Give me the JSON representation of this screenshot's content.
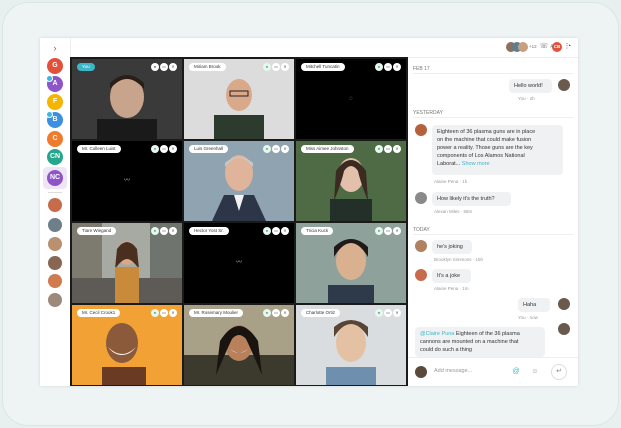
{
  "rail": {
    "collapse_icon": "chevron-right-icon",
    "spaces": [
      {
        "label": "G",
        "color": "#e2513c"
      },
      {
        "label": "A",
        "color": "#8e55c8"
      },
      {
        "label": "F",
        "color": "#f4b400"
      },
      {
        "label": "B",
        "color": "#3d8fe0"
      },
      {
        "label": "C",
        "color": "#f07b2c"
      },
      {
        "label": "CN",
        "color": "#24a78c"
      },
      {
        "label": "NC",
        "color": "#8e55c8"
      }
    ]
  },
  "tiles": [
    {
      "name": "You"
    },
    {
      "name": "Miriam Brook"
    },
    {
      "name": "Mitchell Tuncatin"
    },
    {
      "name": "Mr. Colleen Luist"
    },
    {
      "name": "Luis Greenhall"
    },
    {
      "name": "Miss Aimee Johnston"
    },
    {
      "name": "Tiare Wiegand"
    },
    {
      "name": "Hector Yost Sr."
    },
    {
      "name": "Tricia Kuck"
    },
    {
      "name": "Mr. Cecil Crook1"
    },
    {
      "name": "Mr. Rosemary Moulier"
    },
    {
      "name": "Charlotte Ortiz"
    }
  ],
  "tile_controls": [
    "mic-icon",
    "camera-icon",
    "close-icon"
  ],
  "header": {
    "participant_count": "+12",
    "icons": [
      "phone-icon",
      "cb-badge",
      "clock-icon",
      "search-icon",
      "more-vertical-icon"
    ],
    "badge": "CB"
  },
  "chat": {
    "sections": {
      "feb": "FEB 17",
      "yesterday": "YESTERDAY",
      "today": "TODAY"
    },
    "messages": [
      {
        "text": "Hello world!",
        "meta": "You · 2h"
      },
      {
        "text_lines": [
          "Eighteen of 36 plasma guns are in place",
          "on the machine that could make  fusion",
          "power a reality. Those guns are the key",
          "components of Los Alamos National"
        ],
        "last_line": "Laborat...",
        "link": "Show more",
        "meta": "Alaine Pena · 1h"
      },
      {
        "text": "How likely it's the truth?",
        "meta": "Alexan Miles · 58m"
      },
      {
        "text": "he's joking",
        "meta": "Brooklyn Simmons · 15h"
      },
      {
        "text": "It's a joke",
        "meta": "Alaine Pena · 1m"
      },
      {
        "text": "Haha",
        "meta": "You · now"
      },
      {
        "mention": "@Claire Puna",
        "text_lines": [
          " Eighteen of the 36 plasma",
          "cannons are mounted on a machine that",
          "could do such a thing"
        ]
      }
    ]
  },
  "composer": {
    "placeholder": "Add message...",
    "icons": [
      "mention-icon",
      "emoji-icon",
      "send-icon"
    ]
  }
}
